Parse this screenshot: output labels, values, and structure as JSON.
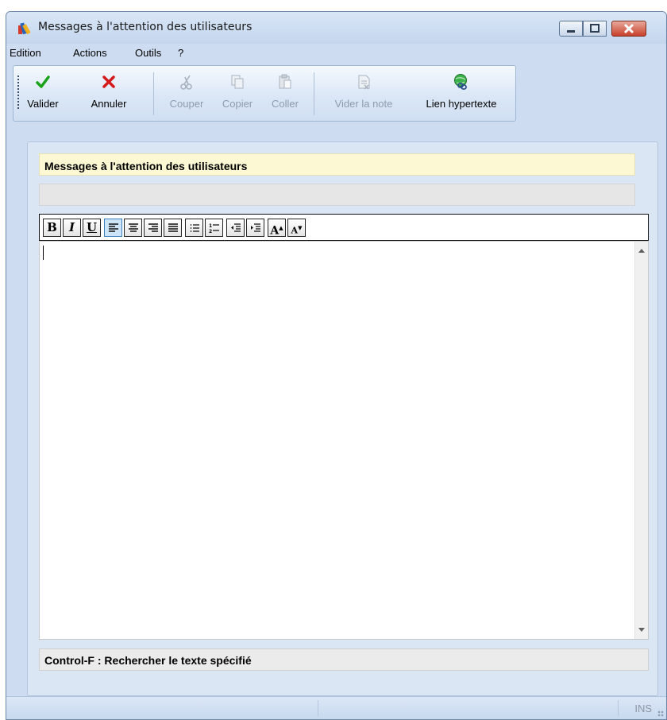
{
  "window": {
    "title": "Messages à l'attention des utilisateurs",
    "icon": "app-books-icon"
  },
  "menu": [
    "Edition",
    "Actions",
    "Outils",
    "?"
  ],
  "toolbar": {
    "buttons": [
      {
        "label": "Valider",
        "icon": "checkmark-icon",
        "enabled": true
      },
      {
        "label": "Annuler",
        "icon": "red-x-icon",
        "enabled": true
      },
      {
        "label": "Couper",
        "icon": "scissors-icon",
        "enabled": false
      },
      {
        "label": "Copier",
        "icon": "copy-icon",
        "enabled": false
      },
      {
        "label": "Coller",
        "icon": "paste-icon",
        "enabled": false
      },
      {
        "label": "Vider la note",
        "icon": "clear-note-icon",
        "enabled": false
      },
      {
        "label": "Lien hypertexte",
        "icon": "globe-link-icon",
        "enabled": true
      }
    ]
  },
  "form": {
    "heading": "Messages à l'attention des utilisateurs",
    "subheading": "",
    "editor_text": "",
    "hint": "Control-F : Rechercher le texte spécifié"
  },
  "format_toolbar": {
    "bold": "B",
    "italic": "I",
    "underline": "U",
    "grow_font": "A",
    "shrink_font": "A",
    "active_alignment": "left"
  },
  "status": {
    "mode": "INS"
  },
  "colors": {
    "accent_green": "#1aa31a",
    "accent_red": "#d41a1a",
    "heading_bg": "#fdf8d4",
    "window_bg": "#cddcf0"
  }
}
